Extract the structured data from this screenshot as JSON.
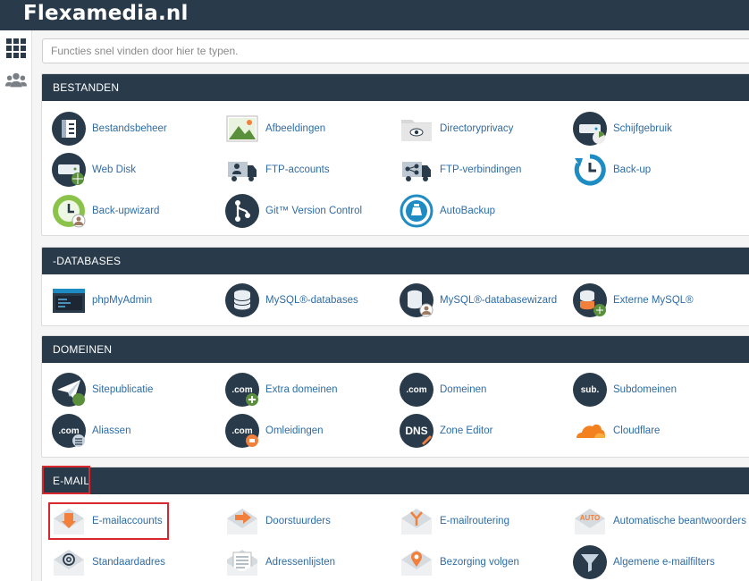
{
  "app": {
    "title": "Flexamedia.nl"
  },
  "search": {
    "placeholder": "Functies snel vinden door hier te typen."
  },
  "sidebar": {
    "items": [
      {
        "icon": "grid-icon"
      },
      {
        "icon": "users-icon"
      }
    ]
  },
  "sections": {
    "bestanden": {
      "title": "BESTANDEN",
      "items": [
        {
          "label": "Bestandsbeheer",
          "icon": "file-manager-icon"
        },
        {
          "label": "Afbeeldingen",
          "icon": "images-icon"
        },
        {
          "label": "Directoryprivacy",
          "icon": "directory-privacy-icon"
        },
        {
          "label": "Schijfgebruik",
          "icon": "disk-usage-icon"
        },
        {
          "label": "Web Disk",
          "icon": "web-disk-icon"
        },
        {
          "label": "FTP-accounts",
          "icon": "ftp-accounts-icon"
        },
        {
          "label": "FTP-verbindingen",
          "icon": "ftp-connections-icon"
        },
        {
          "label": "Back-up",
          "icon": "backup-icon"
        },
        {
          "label": "Back-upwizard",
          "icon": "backup-wizard-icon"
        },
        {
          "label": "Git™ Version Control",
          "icon": "git-icon"
        },
        {
          "label": "AutoBackup",
          "icon": "autobackup-icon"
        }
      ]
    },
    "databases": {
      "title": "-DATABASES",
      "items": [
        {
          "label": "phpMyAdmin",
          "icon": "phpmyadmin-icon"
        },
        {
          "label": "MySQL®-databases",
          "icon": "mysql-databases-icon"
        },
        {
          "label": "MySQL®-databasewizard",
          "icon": "mysql-wizard-icon"
        },
        {
          "label": "Externe MySQL®",
          "icon": "remote-mysql-icon"
        }
      ]
    },
    "domeinen": {
      "title": "DOMEINEN",
      "items": [
        {
          "label": "Sitepublicatie",
          "icon": "site-publisher-icon"
        },
        {
          "label": "Extra domeinen",
          "icon": "addon-domains-icon",
          "badge": ".com"
        },
        {
          "label": "Domeinen",
          "icon": "domains-icon",
          "badge": ".com"
        },
        {
          "label": "Subdomeinen",
          "icon": "subdomains-icon",
          "badge": "sub."
        },
        {
          "label": "Aliassen",
          "icon": "aliases-icon",
          "badge": ".com"
        },
        {
          "label": "Omleidingen",
          "icon": "redirects-icon",
          "badge": ".com"
        },
        {
          "label": "Zone Editor",
          "icon": "zone-editor-icon",
          "badge": "DNS"
        },
        {
          "label": "Cloudflare",
          "icon": "cloudflare-icon"
        }
      ]
    },
    "email": {
      "title": "E-MAIL",
      "items": [
        {
          "label": "E-mailaccounts",
          "icon": "email-accounts-icon"
        },
        {
          "label": "Doorstuurders",
          "icon": "forwarders-icon"
        },
        {
          "label": "E-mailroutering",
          "icon": "email-routing-icon"
        },
        {
          "label": "Automatische beantwoorders",
          "icon": "autoresponders-icon",
          "badge": "AUTO"
        },
        {
          "label": "Standaardadres",
          "icon": "default-address-icon"
        },
        {
          "label": "Adressenlijsten",
          "icon": "mailing-lists-icon"
        },
        {
          "label": "Bezorging volgen",
          "icon": "track-delivery-icon"
        },
        {
          "label": "Algemene e-mailfilters",
          "icon": "global-email-filters-icon"
        }
      ]
    }
  },
  "colors": {
    "header": "#293a4a",
    "link": "#2e6ca4",
    "highlight": "#d9272e",
    "accent_orange": "#f0803c",
    "accent_blue": "#1e8bc3"
  }
}
